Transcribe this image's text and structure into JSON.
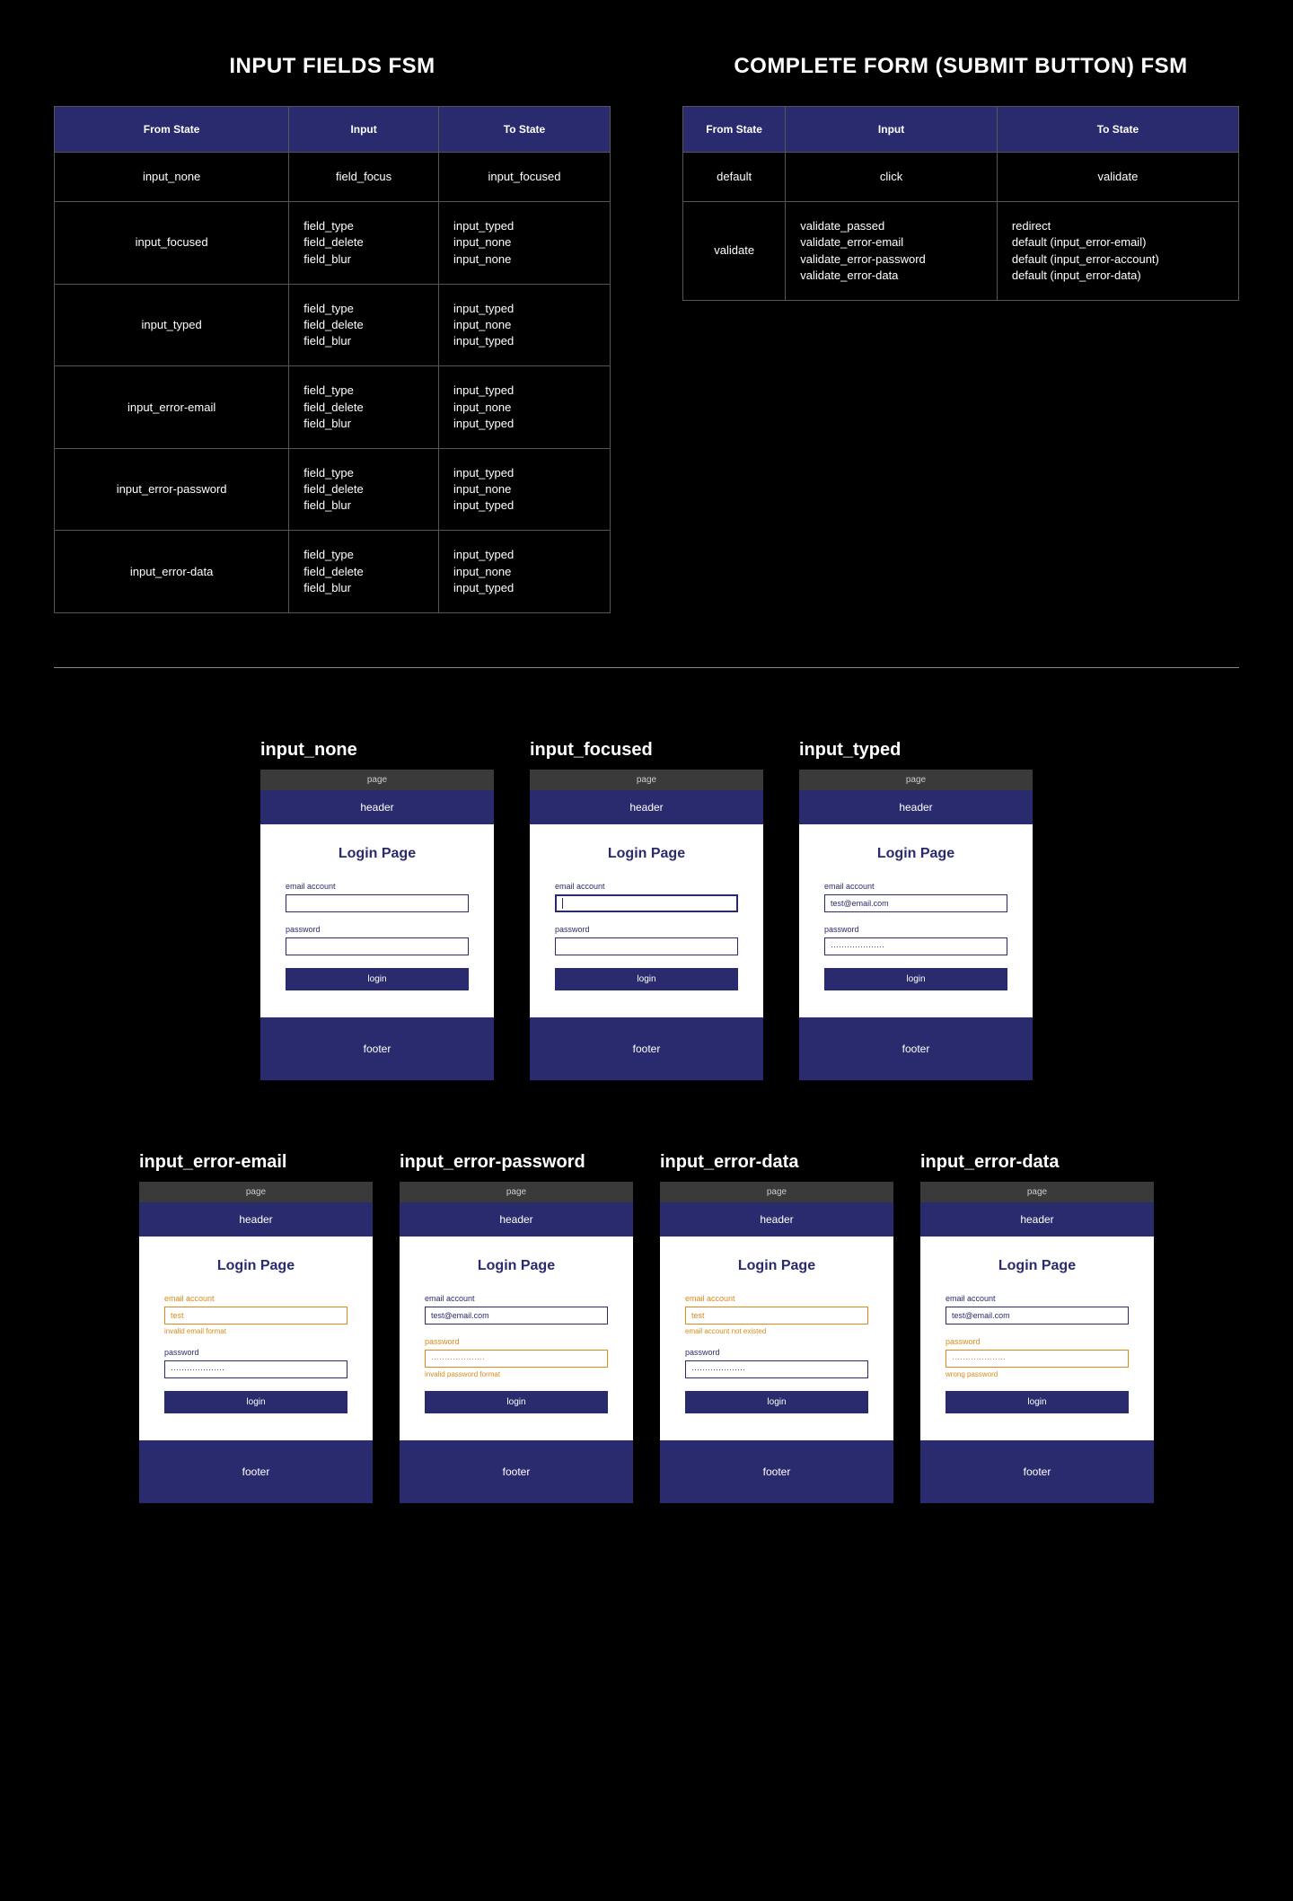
{
  "headings": {
    "input_fsm": "INPUT FIELDS FSM",
    "form_fsm": "COMPLETE FORM (SUBMIT BUTTON) FSM",
    "col_from": "From State",
    "col_input": "Input",
    "col_to": "To State"
  },
  "input_fsm": [
    {
      "from": "input_none",
      "inputs": [
        "field_focus"
      ],
      "to": [
        "input_focused"
      ]
    },
    {
      "from": "input_focused",
      "inputs": [
        "field_type",
        "field_delete",
        "field_blur"
      ],
      "to": [
        "input_typed",
        "input_none",
        "input_none"
      ]
    },
    {
      "from": "input_typed",
      "inputs": [
        "field_type",
        "field_delete",
        "field_blur"
      ],
      "to": [
        "input_typed",
        "input_none",
        "input_typed"
      ]
    },
    {
      "from": "input_error-email",
      "inputs": [
        "field_type",
        "field_delete",
        "field_blur"
      ],
      "to": [
        "input_typed",
        "input_none",
        "input_typed"
      ]
    },
    {
      "from": "input_error-password",
      "inputs": [
        "field_type",
        "field_delete",
        "field_blur"
      ],
      "to": [
        "input_typed",
        "input_none",
        "input_typed"
      ]
    },
    {
      "from": "input_error-data",
      "inputs": [
        "field_type",
        "field_delete",
        "field_blur"
      ],
      "to": [
        "input_typed",
        "input_none",
        "input_typed"
      ]
    }
  ],
  "form_fsm": [
    {
      "from": "default",
      "inputs": [
        "click"
      ],
      "to": [
        "validate"
      ]
    },
    {
      "from": "validate",
      "inputs": [
        "validate_passed",
        "validate_error-email",
        "validate_error-password",
        "validate_error-data"
      ],
      "to": [
        "redirect",
        "default (input_error-email)",
        "default (input_error-account)",
        "default (input_error-data)"
      ]
    }
  ],
  "mock": {
    "page": "page",
    "header": "header",
    "footer": "footer",
    "title": "Login Page",
    "email_label": "email account",
    "password_label": "password",
    "login": "login",
    "email_value": "test@email.com",
    "email_bad": "test",
    "pwd_dots": "····················",
    "err_email_format": "invalid email format",
    "err_pwd_format": "invalid password format",
    "err_account": "email account not existed",
    "err_wrong_pwd": "wrong password"
  },
  "states": {
    "s1": "input_none",
    "s2": "input_focused",
    "s3": "input_typed",
    "s4": "input_error-email",
    "s5": "input_error-password",
    "s6": "input_error-data",
    "s7": "input_error-data"
  }
}
